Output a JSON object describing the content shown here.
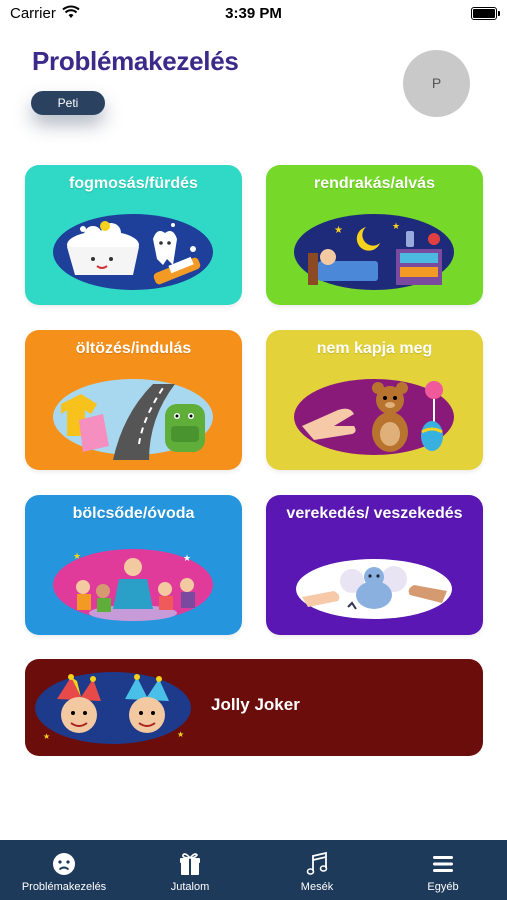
{
  "status_bar": {
    "carrier": "Carrier",
    "time": "3:39 PM"
  },
  "header": {
    "title": "Problémakezelés",
    "user_name": "Peti",
    "avatar_initial": "P"
  },
  "tiles": [
    {
      "label": "fogmosás/fürdés",
      "color": "#2fd9c5"
    },
    {
      "label": "rendrakás/alvás",
      "color": "#76d92a"
    },
    {
      "label": "öltözés/indulás",
      "color": "#f5901a"
    },
    {
      "label": "nem kapja meg",
      "color": "#e3d23a"
    },
    {
      "label": "bölcsőde/óvoda",
      "color": "#2596de"
    },
    {
      "label": "verekedés/ veszekedés",
      "color": "#5a17b3"
    }
  ],
  "wide_tile": {
    "label": "Jolly Joker",
    "color": "#6b0d0b"
  },
  "tab_bar": [
    {
      "label": "Problémakezelés",
      "icon": "sad-face-icon"
    },
    {
      "label": "Jutalom",
      "icon": "gift-icon"
    },
    {
      "label": "Mesék",
      "icon": "music-note-icon"
    },
    {
      "label": "Egyéb",
      "icon": "menu-icon"
    }
  ]
}
